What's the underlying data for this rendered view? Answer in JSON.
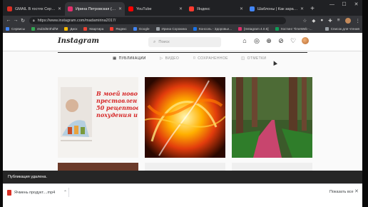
{
  "browser": {
    "tabs": [
      {
        "title": "GMAIL В гостях Сергей Sor",
        "favicon_color": "#d93025",
        "active": false
      },
      {
        "title": "Ирина Петровская (@mad",
        "favicon_color": "#e1306c",
        "active": true
      },
      {
        "title": "YouTube",
        "favicon_color": "#ff0000",
        "active": false
      },
      {
        "title": "Яндекс",
        "favicon_color": "#ff3b30",
        "active": false
      },
      {
        "title": "Шаблоны | Как заработ",
        "favicon_color": "#4285f4",
        "active": false
      }
    ],
    "new_tab_label": "+",
    "window_controls": {
      "minimize": "—",
      "maximize": "☐",
      "close": "✕"
    },
    "address": "https://www.instagram.com/madamirina2017/",
    "bookmarks": [
      {
        "label": "Сервисы",
        "color": "#4285f4"
      },
      {
        "label": "4sd2d5r3hdfM",
        "color": "#34a853"
      },
      {
        "label": "Диск",
        "color": "#fbbc04"
      },
      {
        "label": "Квартира",
        "color": "#ea4335"
      },
      {
        "label": "Яндекс",
        "color": "#ff3b30"
      },
      {
        "label": "Google",
        "color": "#4285f4"
      },
      {
        "label": "Ирина Сорокина",
        "color": "#9aa0a6"
      },
      {
        "label": "Консоль - Здоровье...",
        "color": "#1a73e8"
      },
      {
        "label": "[Instagram 4.0.5]",
        "color": "#e1306c"
      },
      {
        "label": "Хостинг TimeWeb -...",
        "color": "#0f9d58"
      }
    ],
    "other_bookmarks": "Список для чтения"
  },
  "instagram": {
    "logo": "Instagram",
    "search_placeholder": "Поиск",
    "nav_icons": [
      "home-icon",
      "messenger-icon",
      "new-post-icon",
      "explore-icon",
      "heart-icon"
    ],
    "profile_tabs": [
      {
        "label": "ПУБЛИКАЦИИ",
        "icon": "▦",
        "active": true
      },
      {
        "label": "ВИДЕО",
        "icon": "▷",
        "active": false
      },
      {
        "label": "СОХРАНЕННОЕ",
        "icon": "⌑",
        "active": false
      },
      {
        "label": "ОТМЕТКИ",
        "icon": "◫",
        "active": false
      }
    ],
    "posts": [
      {
        "kind": "promo",
        "lines": [
          "В моей ново",
          "преставлен",
          "50 рецептов",
          "похудения и"
        ]
      },
      {
        "kind": "image",
        "description": "fractal-fire"
      },
      {
        "kind": "image",
        "description": "forest-path"
      }
    ]
  },
  "toast": {
    "message": "Публикация удалена."
  },
  "downloads": {
    "item_name": "Ячмень продукт....mp4",
    "show_all": "Показать все",
    "close": "✕"
  }
}
